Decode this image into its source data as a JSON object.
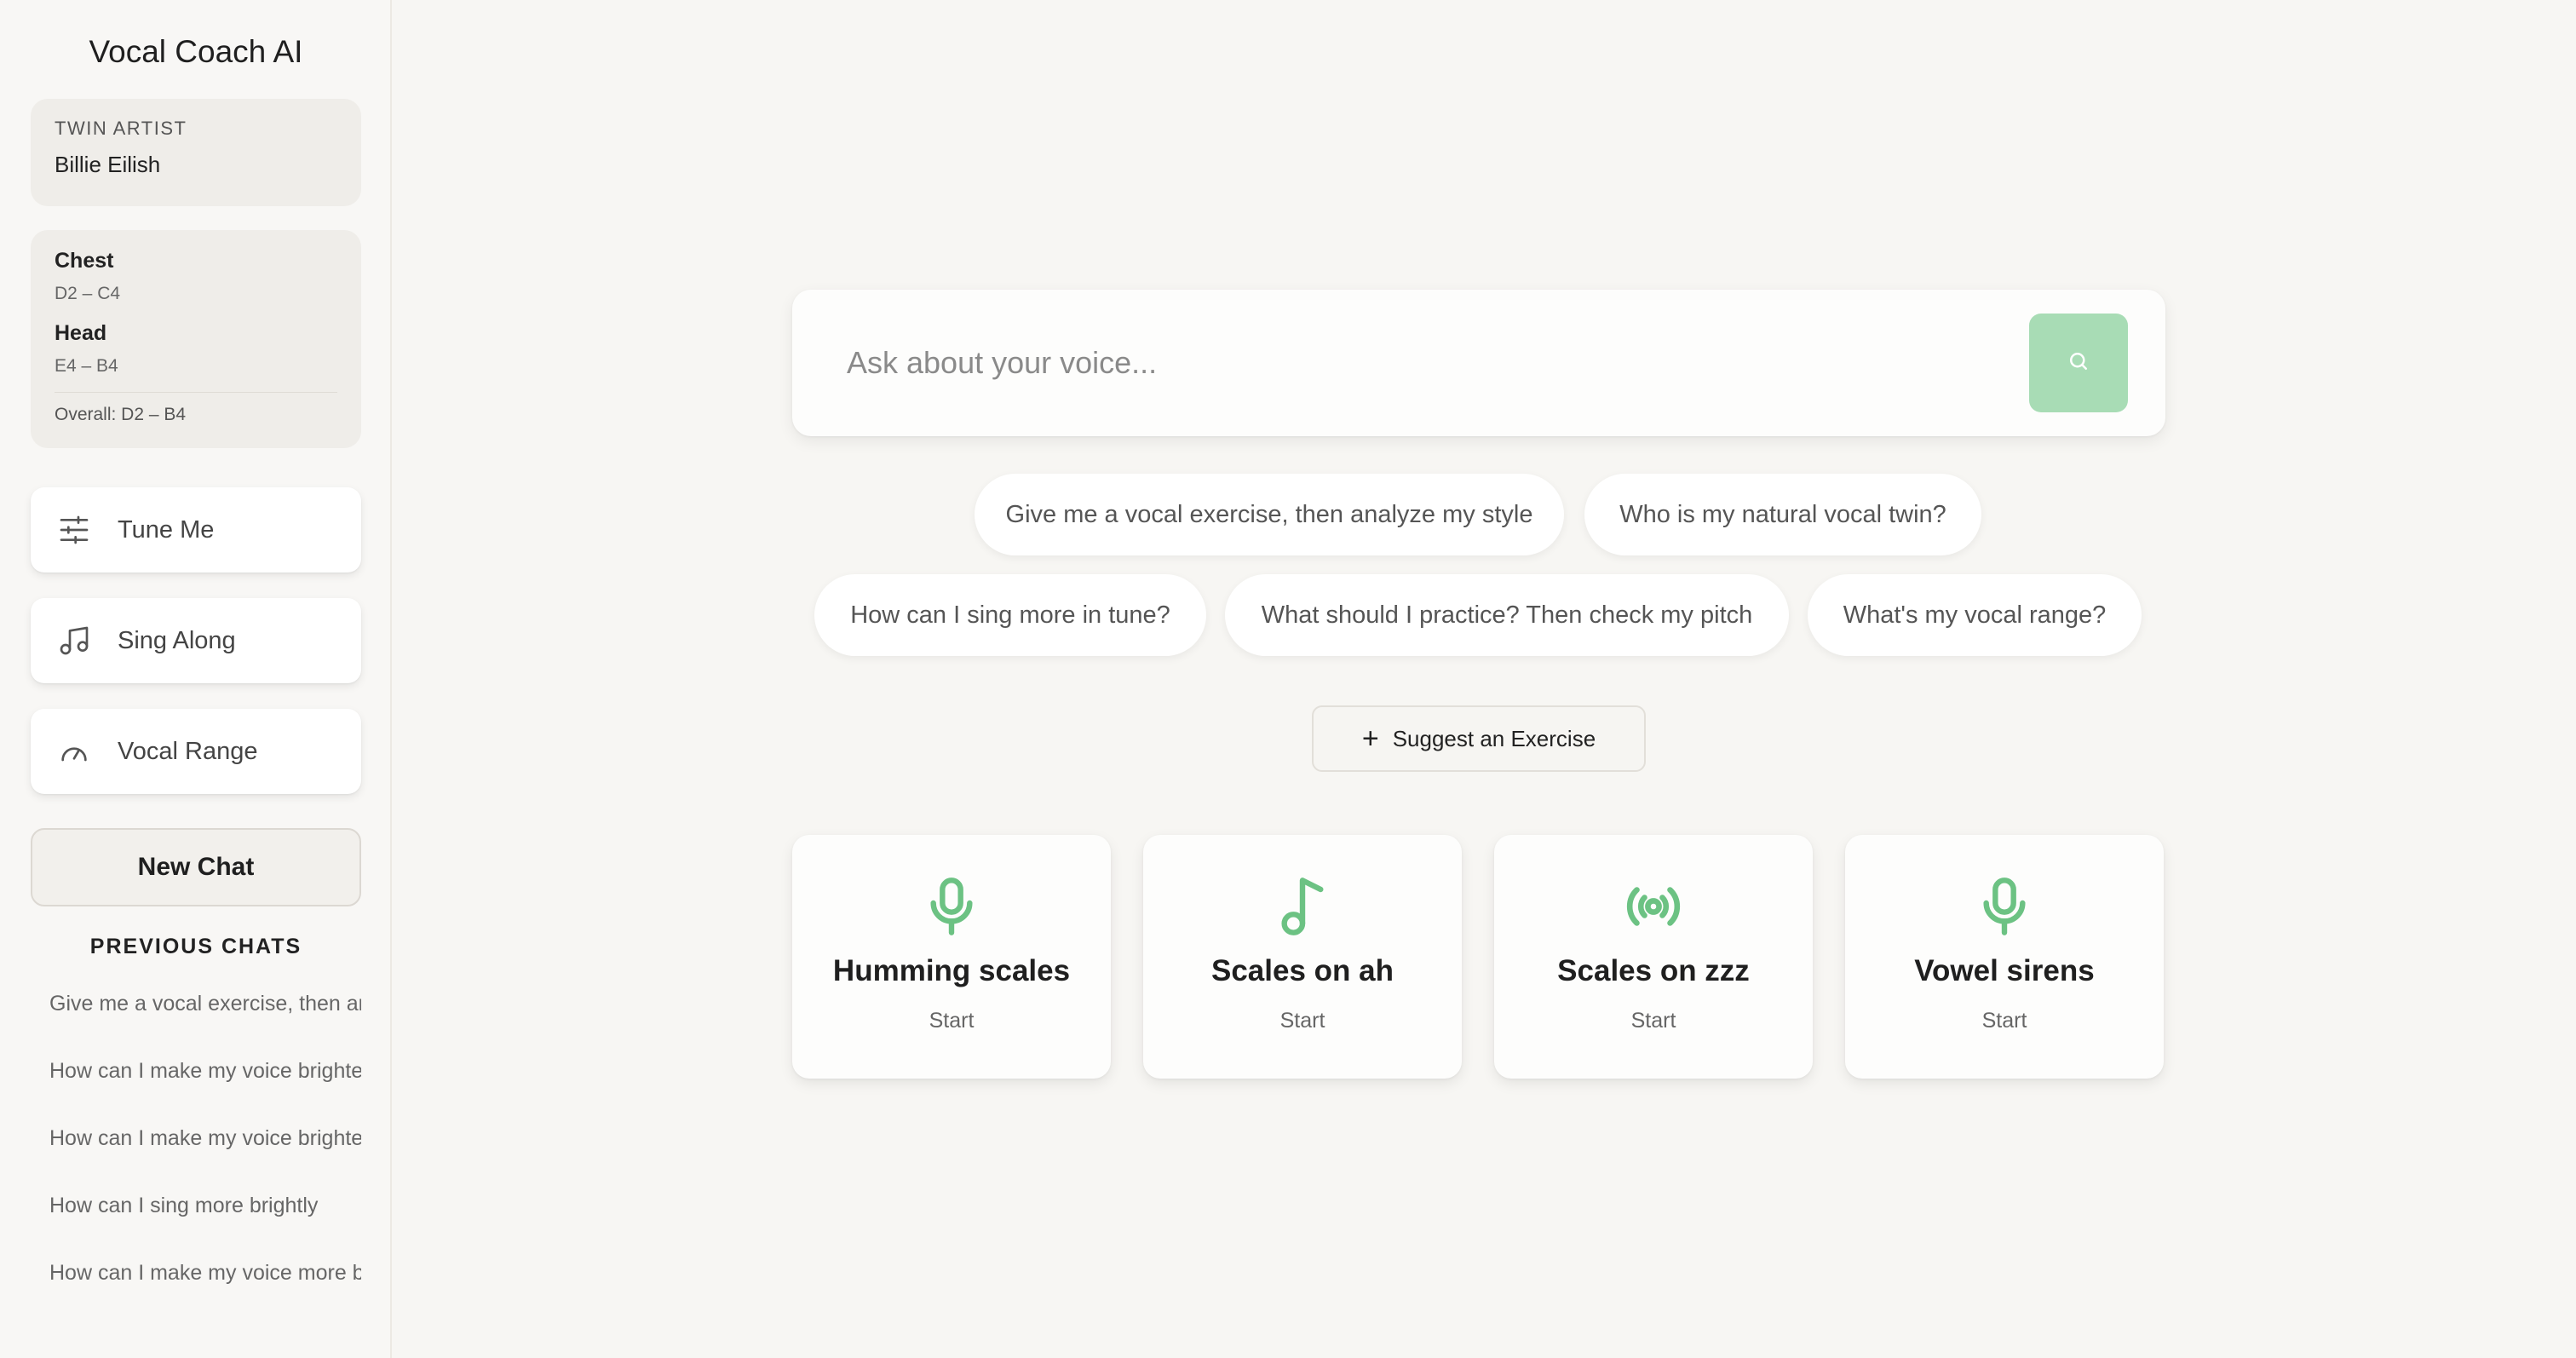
{
  "app_title": "Vocal Coach AI",
  "twin": {
    "label": "TWIN ARTIST",
    "name": "Billie Eilish"
  },
  "range": {
    "chest_label": "Chest",
    "chest_range": "D2 – C4",
    "head_label": "Head",
    "head_range": "E4 – B4",
    "overall": "Overall: D2 – B4"
  },
  "nav": [
    {
      "label": "Tune Me",
      "icon": "sliders-icon"
    },
    {
      "label": "Sing Along",
      "icon": "music-note-icon"
    },
    {
      "label": "Vocal Range",
      "icon": "gauge-icon"
    }
  ],
  "new_chat_label": "New Chat",
  "previous_chats": {
    "title": "PREVIOUS CHATS",
    "items": [
      "Give me a vocal exercise, then analyze my style",
      "How can I make my voice brighter?",
      "How can I make my voice brighter?",
      "How can I sing more brightly",
      "How can I make my voice more bright?"
    ]
  },
  "search": {
    "placeholder": "Ask about your voice...",
    "button_icon": "search-icon"
  },
  "chips": [
    "Give me a vocal exercise, then analyze my style",
    "Who is my natural vocal twin?",
    "How can I sing more in tune?",
    "What should I practice? Then check my pitch",
    "What's my vocal range?"
  ],
  "suggest_label": "Suggest an Exercise",
  "exercises": [
    {
      "title": "Humming scales",
      "action": "Start",
      "icon": "microphone-icon"
    },
    {
      "title": "Scales on ah",
      "action": "Start",
      "icon": "music-note-icon"
    },
    {
      "title": "Scales on zzz",
      "action": "Start",
      "icon": "broadcast-icon"
    },
    {
      "title": "Vowel sirens",
      "action": "Start",
      "icon": "microphone-icon"
    }
  ],
  "colors": {
    "accent": "#6cc283",
    "search_button": "#a8dcb5",
    "background": "#f7f6f3"
  }
}
